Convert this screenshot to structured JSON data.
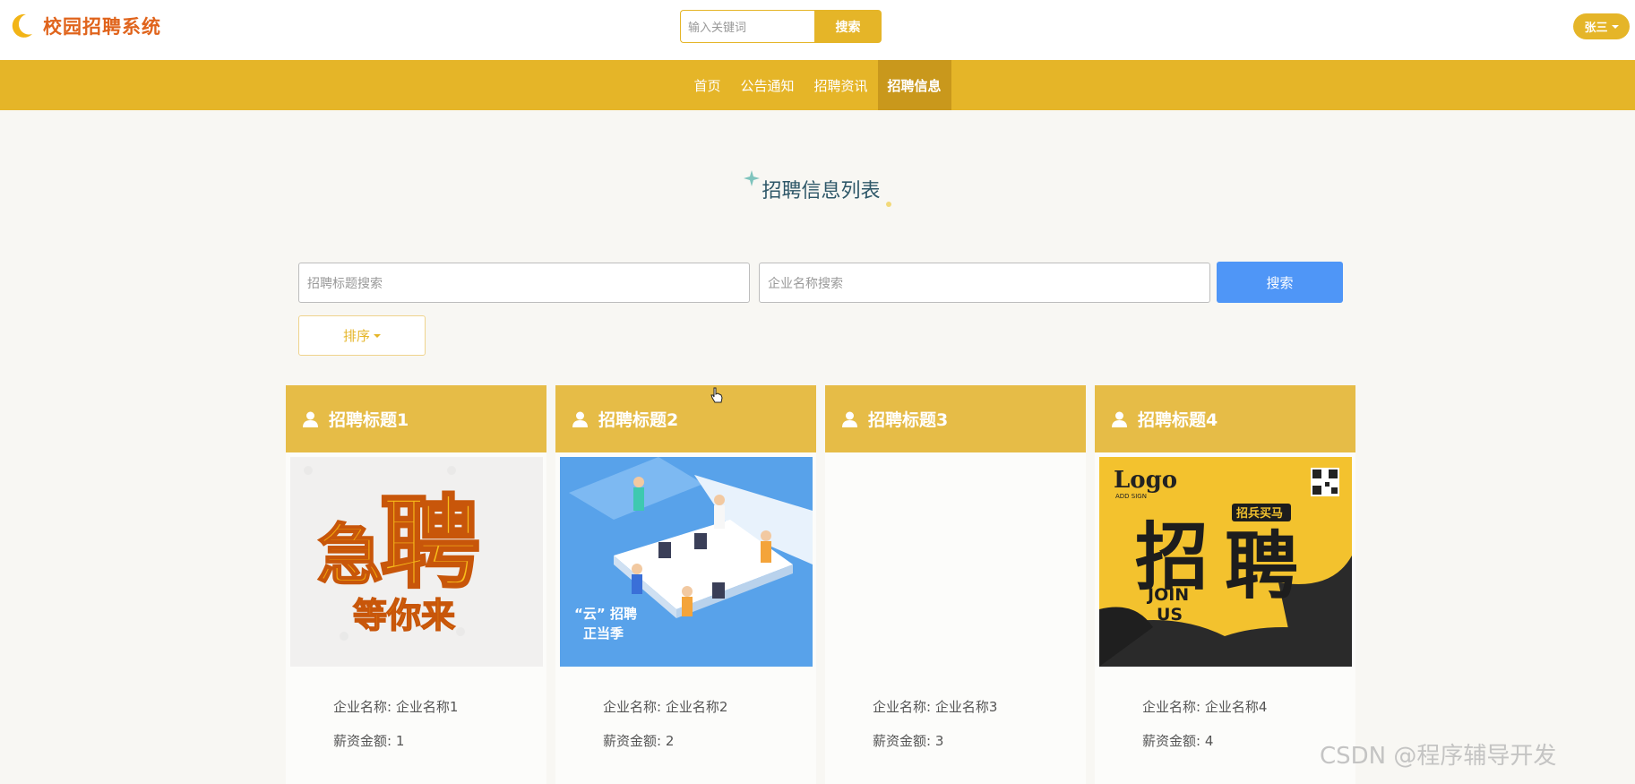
{
  "header": {
    "brand_name": "校园招聘系统",
    "search_placeholder": "输入关键词",
    "search_button": "搜索",
    "user_name": "张三"
  },
  "nav": {
    "items": [
      {
        "label": "首页",
        "active": false
      },
      {
        "label": "公告通知",
        "active": false
      },
      {
        "label": "招聘资讯",
        "active": false
      },
      {
        "label": "招聘信息",
        "active": true
      }
    ]
  },
  "section": {
    "title": "招聘信息列表"
  },
  "filters": {
    "title_placeholder": "招聘标题搜索",
    "company_placeholder": "企业名称搜索",
    "search_button": "搜索",
    "sort_label": "排序"
  },
  "cards": [
    {
      "title": "招聘标题1",
      "company_label": "企业名称: 企业名称1",
      "salary_label": "薪资金额: 1",
      "image": "poster-hiring-yellow"
    },
    {
      "title": "招聘标题2",
      "company_label": "企业名称: 企业名称2",
      "salary_label": "薪资金额: 2",
      "image": "illustration-office-blue",
      "image_text": [
        "“云” 招聘",
        "正当季"
      ]
    },
    {
      "title": "招聘标题3",
      "company_label": "企业名称: 企业名称3",
      "salary_label": "薪资金额: 3",
      "image": "blank"
    },
    {
      "title": "招聘标题4",
      "company_label": "企业名称: 企业名称4",
      "salary_label": "薪资金额: 4",
      "image": "poster-join-us",
      "image_text": [
        "Logo",
        "ADD SIGN",
        "招兵买马",
        "JOIN",
        "US"
      ]
    }
  ],
  "poster1_text": [
    "急",
    "聘",
    "等你来"
  ],
  "poster4_big": [
    "招",
    "聘"
  ],
  "watermark": "CSDN @程序辅导开发",
  "colors": {
    "accent": "#e5b528",
    "nav_active": "#c9981c",
    "card_header": "#e6bc47",
    "primary_button": "#4f96f7",
    "brand_text": "#e0641c"
  }
}
